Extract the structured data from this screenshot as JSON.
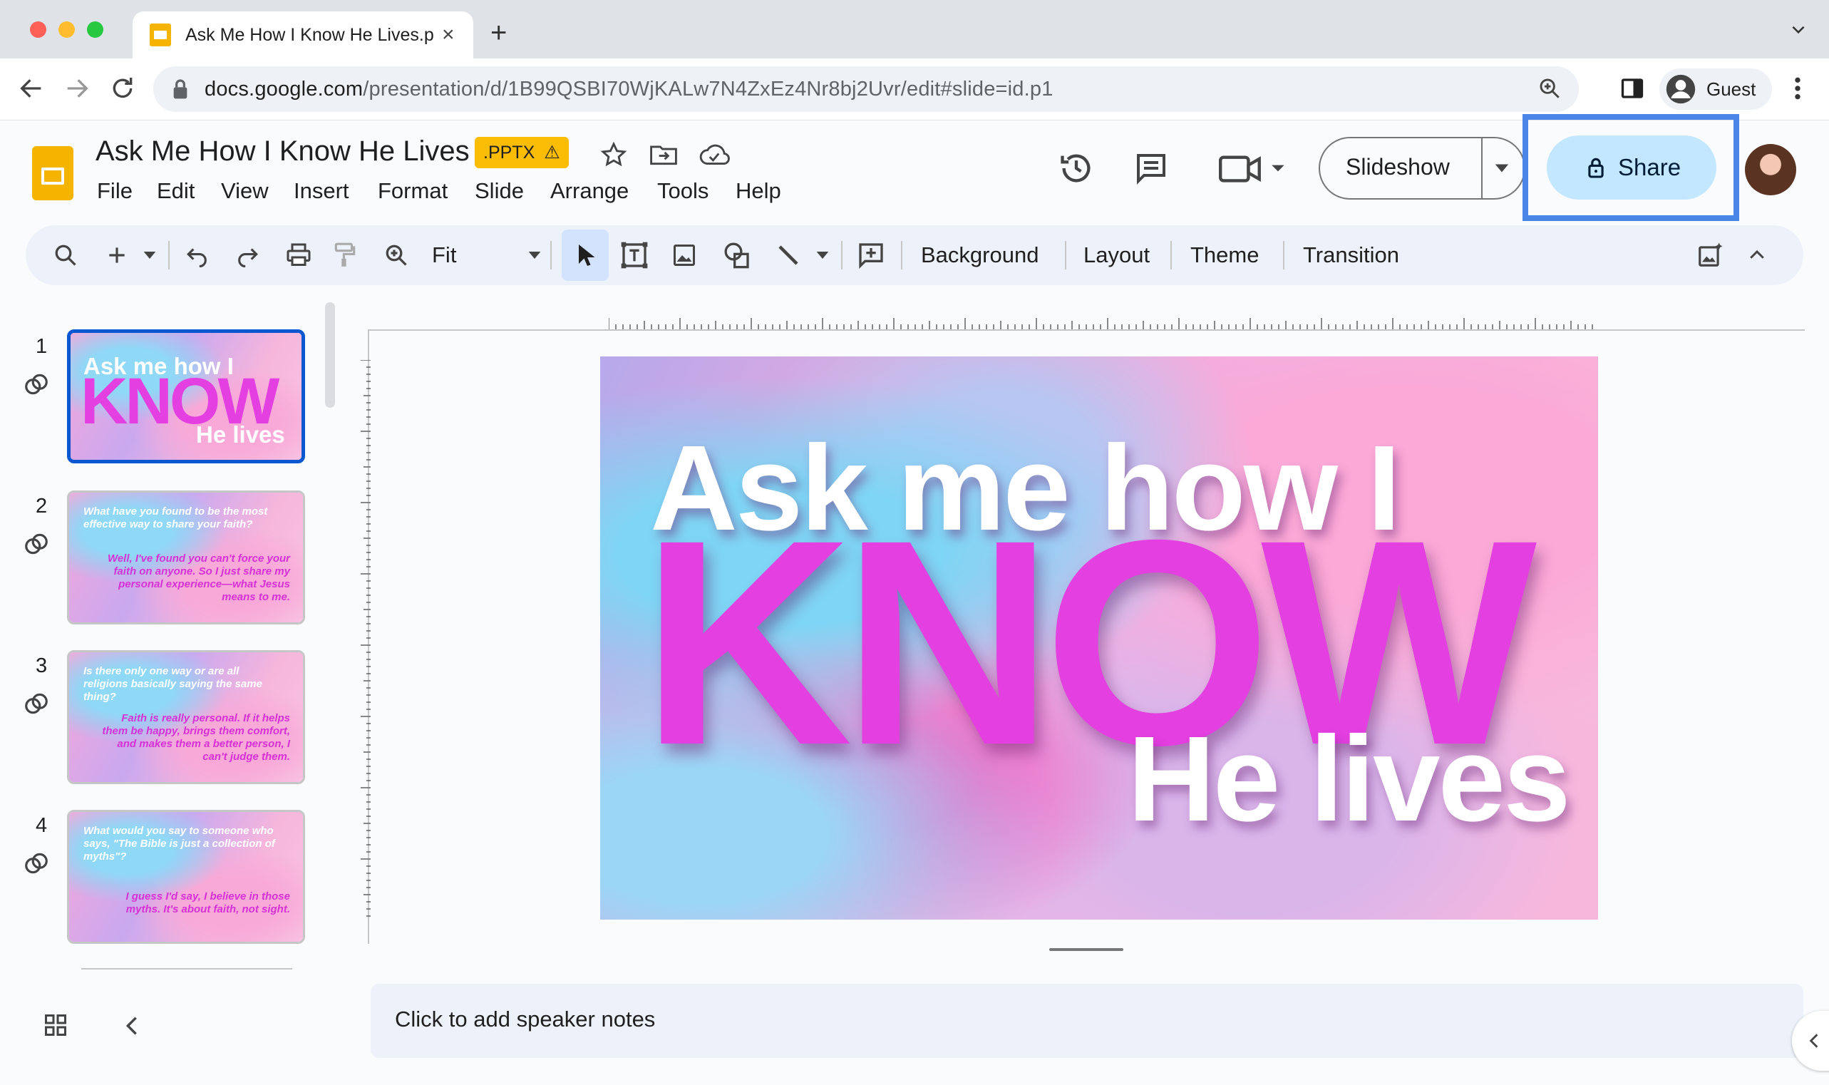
{
  "browser": {
    "tab_title": "Ask Me How I Know He Lives.p",
    "url_host": "docs.google.com",
    "url_path": "/presentation/d/1B99QSBI70WjKALw7N4ZxEz4Nr8bj2Uvr/edit#slide=id.p1",
    "profile_label": "Guest"
  },
  "app": {
    "doc_title": "Ask Me How I Know He Lives",
    "file_badge": ".PPTX",
    "menu": [
      "File",
      "Edit",
      "View",
      "Insert",
      "Format",
      "Slide",
      "Arrange",
      "Tools",
      "Help"
    ],
    "slideshow_label": "Slideshow",
    "share_label": "Share"
  },
  "toolbar": {
    "zoom_value": "Fit",
    "background_label": "Background",
    "layout_label": "Layout",
    "theme_label": "Theme",
    "transition_label": "Transition"
  },
  "slides": [
    {
      "number": "1",
      "title_line1": "Ask me how I",
      "title_line2": "KNOW",
      "title_line3": "He lives"
    },
    {
      "number": "2",
      "question": "What have you found to be the most effective way to share your faith?",
      "answer": "Well, I've found you can't force your faith on anyone. So I just share my personal experience—what Jesus means to me."
    },
    {
      "number": "3",
      "question": "Is there only one way or are all religions basically saying the same thing?",
      "answer": "Faith is really personal. If it helps them be happy, brings them comfort, and makes them a better person, I can't judge them."
    },
    {
      "number": "4",
      "question": "What would you say to someone who says, \"The Bible is just a collection of myths\"?",
      "answer": "I guess I'd say, I believe in those myths. It's about faith, not sight."
    }
  ],
  "canvas": {
    "line1": "Ask me how I",
    "line2": "KNOW",
    "line3": "He lives"
  },
  "notes": {
    "placeholder": "Click to add speaker notes"
  },
  "colors": {
    "accent": "#0b57d0",
    "share_bg": "#c2e7ff",
    "highlight": "#4a86e8",
    "slides_yellow": "#f4b400",
    "know_pink": "#e43fe0"
  }
}
